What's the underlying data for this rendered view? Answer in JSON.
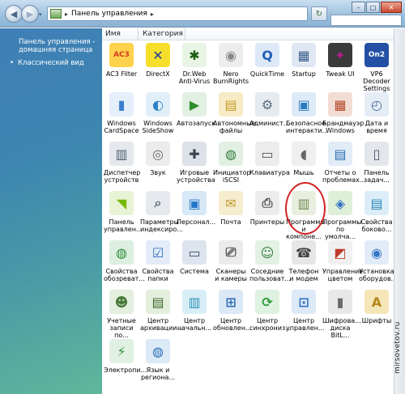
{
  "address": {
    "path": "Панель управления",
    "sep": "▸",
    "chevron": "▸"
  },
  "nav": {
    "back": "◀",
    "forward": "▶",
    "dropdown": "▾",
    "refresh": "↻"
  },
  "window_buttons": {
    "min": "–",
    "max": "□",
    "close": "✕"
  },
  "sidebar": {
    "home": "Панель управления - домашняя страница",
    "classic": "Классический вид"
  },
  "columns": {
    "name": "Имя",
    "category": "Категория"
  },
  "items": [
    {
      "label": "AC3 Filter",
      "icon": "ac3-icon",
      "glyph": "AC3",
      "color": "#d13b1f",
      "bg": "#ffd24d"
    },
    {
      "label": "DirectX",
      "icon": "directx-icon",
      "glyph": "✕",
      "color": "#1f3b9b",
      "bg": "#f5df2a"
    },
    {
      "label": "Dr.Web Anti-Virus",
      "icon": "spider-icon",
      "glyph": "✱",
      "color": "#1a5e12",
      "bg": "#e8f4e4"
    },
    {
      "label": "Nero BurnRights",
      "icon": "nero-icon",
      "glyph": "◉",
      "color": "#888888",
      "bg": "#ededed"
    },
    {
      "label": "QuickTime",
      "icon": "quicktime-icon",
      "glyph": "Q",
      "color": "#1f5fb8",
      "bg": "#dde9f7"
    },
    {
      "label": "Startup",
      "icon": "startup-icon",
      "glyph": "▦",
      "color": "#3b5d8a",
      "bg": "#dfe8f2"
    },
    {
      "label": "Tweak UI",
      "icon": "tweakui-icon",
      "glyph": "✦",
      "color": "#b01f8c",
      "bg": "#3a3a3a"
    },
    {
      "label": "VP6 Decoder Settings",
      "icon": "vp6-icon",
      "glyph": "On2",
      "color": "#ffffff",
      "bg": "#2350a4"
    },
    {
      "label": "Windows CardSpace",
      "icon": "cardspace-icon",
      "glyph": "▮",
      "color": "#3a7fd0",
      "bg": "#e5effa"
    },
    {
      "label": "Windows SideShow",
      "icon": "sideshow-icon",
      "glyph": "◐",
      "color": "#2e82c7",
      "bg": "#e1eff8"
    },
    {
      "label": "Автозапуск",
      "icon": "autoplay-icon",
      "glyph": "▶",
      "color": "#2f8d2f",
      "bg": "#e2f0e2"
    },
    {
      "label": "Автономные файлы",
      "icon": "offline-files-icon",
      "glyph": "▤",
      "color": "#c59a27",
      "bg": "#f7ebc5"
    },
    {
      "label": "Админист...",
      "icon": "admin-tools-icon",
      "glyph": "⚙",
      "color": "#5a6c80",
      "bg": "#e6ebf0"
    },
    {
      "label": "Безопасное интеракти...",
      "icon": "safe-interactive-icon",
      "glyph": "▣",
      "color": "#2d7bbf",
      "bg": "#dcebf7"
    },
    {
      "label": "Брандмауэр Windows",
      "icon": "firewall-icon",
      "glyph": "▦",
      "color": "#b5482a",
      "bg": "#f2ddd4"
    },
    {
      "label": "Дата и время",
      "icon": "datetime-icon",
      "glyph": "◴",
      "color": "#4a6c9a",
      "bg": "#e4ecf5"
    },
    {
      "label": "Диспетчер устройств",
      "icon": "device-manager-icon",
      "glyph": "▥",
      "color": "#4d5d6e",
      "bg": "#e5e9ee"
    },
    {
      "label": "Звук",
      "icon": "sound-icon",
      "glyph": "◎",
      "color": "#6b6b6b",
      "bg": "#ececec"
    },
    {
      "label": "Игровые устройства",
      "icon": "gamepad-icon",
      "glyph": "✚",
      "color": "#3b4450",
      "bg": "#dde2e8"
    },
    {
      "label": "Инициатор iSCSI",
      "icon": "iscsi-icon",
      "glyph": "◍",
      "color": "#2f7a38",
      "bg": "#e1f0e3"
    },
    {
      "label": "Клавиатура",
      "icon": "keyboard-icon",
      "glyph": "▭",
      "color": "#555555",
      "bg": "#ececec"
    },
    {
      "label": "Мышь",
      "icon": "mouse-icon",
      "glyph": "◖",
      "color": "#666666",
      "bg": "#efefef"
    },
    {
      "label": "Отчеты о проблемах...",
      "icon": "problem-reports-icon",
      "glyph": "▤",
      "color": "#2b6fb3",
      "bg": "#e1ecf7"
    },
    {
      "label": "Панель задач...",
      "icon": "taskbar-icon",
      "glyph": "▯",
      "color": "#4b5866",
      "bg": "#e3e7ec"
    },
    {
      "label": "Панель управлен...",
      "icon": "nvidia-icon",
      "glyph": "◥",
      "color": "#76b900",
      "bg": "#e9f3d6"
    },
    {
      "label": "Параметры индексиро...",
      "icon": "indexing-icon",
      "glyph": "⌕",
      "color": "#5b6876",
      "bg": "#e6e9ee"
    },
    {
      "label": "Персонал...",
      "icon": "personalization-icon",
      "glyph": "▣",
      "color": "#2578c7",
      "bg": "#d7e8f7"
    },
    {
      "label": "Почта",
      "icon": "mail-icon",
      "glyph": "✉",
      "color": "#c29a2d",
      "bg": "#f6edcf"
    },
    {
      "label": "Принтеры",
      "icon": "printer-icon",
      "glyph": "⎙",
      "color": "#555555",
      "bg": "#ececec"
    },
    {
      "label": "Программы и компоне...",
      "icon": "programs-features-icon",
      "glyph": "▥",
      "color": "#6f8a52",
      "bg": "#e8efdf"
    },
    {
      "label": "Программы по умолча...",
      "icon": "default-programs-icon",
      "glyph": "◈",
      "color": "#2c6fc2",
      "bg": "#dff0d8"
    },
    {
      "label": "Свойства боково...",
      "icon": "sidebar-properties-icon",
      "glyph": "▤",
      "color": "#2a87b8",
      "bg": "#dbeef7"
    },
    {
      "label": "Свойства обозреват...",
      "icon": "internet-options-icon",
      "glyph": "◍",
      "color": "#2f8d3a",
      "bg": "#dcefe0"
    },
    {
      "label": "Свойства папки",
      "icon": "folder-options-icon",
      "glyph": "☑",
      "color": "#2a6cbf",
      "bg": "#e3ecf8"
    },
    {
      "label": "Система",
      "icon": "system-icon",
      "glyph": "▭",
      "color": "#3a4c66",
      "bg": "#dde4ee"
    },
    {
      "label": "Сканеры и камеры",
      "icon": "scanner-icon",
      "glyph": "⎚",
      "color": "#555555",
      "bg": "#ebebeb"
    },
    {
      "label": "Соседние пользоват...",
      "icon": "people-near-me-icon",
      "glyph": "☺",
      "color": "#2f7a38",
      "bg": "#e3f0e4"
    },
    {
      "label": "Телефон и модем",
      "icon": "phone-modem-icon",
      "glyph": "☎",
      "color": "#444444",
      "bg": "#e6e6e6"
    },
    {
      "label": "Управление цветом",
      "icon": "color-management-icon",
      "glyph": "◩",
      "color": "#c1392b",
      "bg": "#f0f0f0"
    },
    {
      "label": "Установка оборудов...",
      "icon": "add-hardware-icon",
      "glyph": "◉",
      "color": "#3276c4",
      "bg": "#e2ecf8"
    },
    {
      "label": "Учетные записи по...",
      "icon": "user-accounts-icon",
      "glyph": "☻",
      "color": "#4a7a3a",
      "bg": "#e4efdf"
    },
    {
      "label": "Центр архивации...",
      "icon": "backup-icon",
      "glyph": "▤",
      "color": "#3e6a2a",
      "bg": "#e3eedd"
    },
    {
      "label": "Центр начальн...",
      "icon": "welcome-center-icon",
      "glyph": "▥",
      "color": "#2d8fb8",
      "bg": "#d8eef7"
    },
    {
      "label": "Центр обновлен...",
      "icon": "windows-update-icon",
      "glyph": "⊞",
      "color": "#2f6db6",
      "bg": "#dbe8f6"
    },
    {
      "label": "Центр синхрониз...",
      "icon": "sync-center-icon",
      "glyph": "⟳",
      "color": "#2f9a3a",
      "bg": "#dff2e1"
    },
    {
      "label": "Центр управлен...",
      "icon": "network-center-icon",
      "glyph": "⊡",
      "color": "#2d72c0",
      "bg": "#dde9f7"
    },
    {
      "label": "Шифрова... диска BitL...",
      "icon": "bitlocker-icon",
      "glyph": "▮",
      "color": "#6b6b6b",
      "bg": "#e8e8e8"
    },
    {
      "label": "Шрифты",
      "icon": "fonts-icon",
      "glyph": "A",
      "color": "#b38719",
      "bg": "#f5e6b8"
    },
    {
      "label": "Электропи...",
      "icon": "power-options-icon",
      "glyph": "⚡",
      "color": "#2f8d3a",
      "bg": "#e0f0e2"
    },
    {
      "label": "Язык и региона...",
      "icon": "region-language-icon",
      "glyph": "◍",
      "color": "#2a6fb8",
      "bg": "#dce9f6"
    }
  ],
  "watermark": "mirsovetov.ru"
}
